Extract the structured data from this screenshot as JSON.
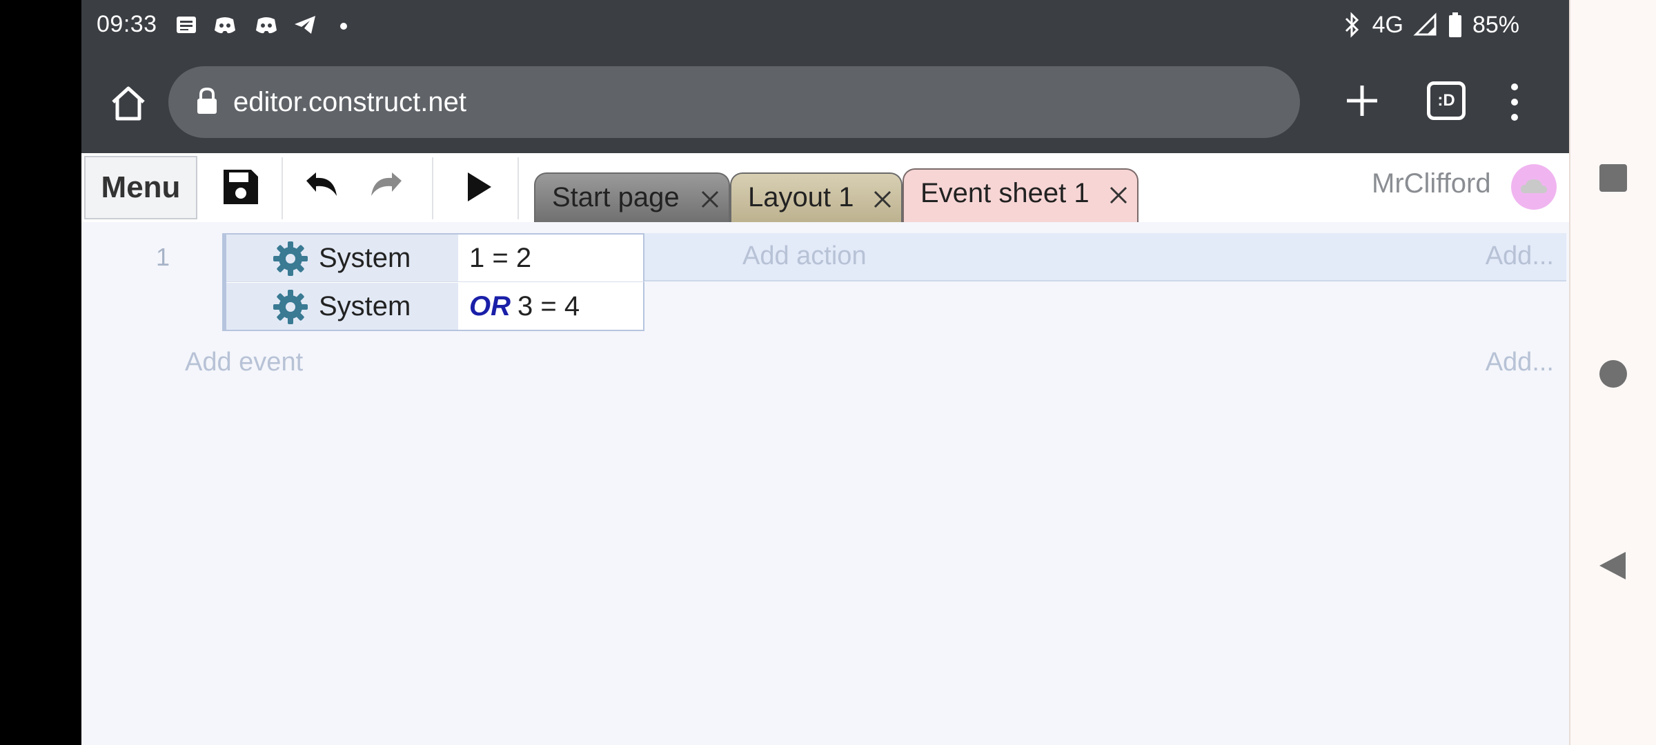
{
  "status_bar": {
    "time": "09:33",
    "network": "4G",
    "battery": "85%",
    "left_icons": [
      "news-icon",
      "discord-icon",
      "discord-icon",
      "telegram-icon",
      "dot-icon"
    ],
    "right_icons": [
      "bluetooth-icon",
      "signal-icon",
      "battery-icon"
    ]
  },
  "browser": {
    "url": "editor.construct.net",
    "tab_count_label": ":D"
  },
  "toolbar": {
    "menu_label": "Menu",
    "username": "MrClifford"
  },
  "tabs": [
    {
      "label": "Start page",
      "color": "#7f7f7f"
    },
    {
      "label": "Layout 1",
      "color": "#cbc29f"
    },
    {
      "label": "Event sheet 1",
      "color": "#f7d5d5",
      "active": true
    }
  ],
  "event_sheet": {
    "events": [
      {
        "number": "1",
        "conditions": [
          {
            "object": "System",
            "text": "1 = 2",
            "or": false
          },
          {
            "object": "System",
            "or_label": "OR",
            "text": "3 = 4",
            "or": true
          }
        ],
        "add_action": "Add action",
        "add_more": "Add..."
      }
    ],
    "add_event": "Add event",
    "add_event_more": "Add..."
  },
  "colors": {
    "status_bar_bg": "#3b3e43",
    "url_bar_bg": "#606469",
    "gear_icon": "#3a7a93",
    "or_keyword": "#1a1fa8",
    "placeholder_text": "#b7c2d6"
  }
}
